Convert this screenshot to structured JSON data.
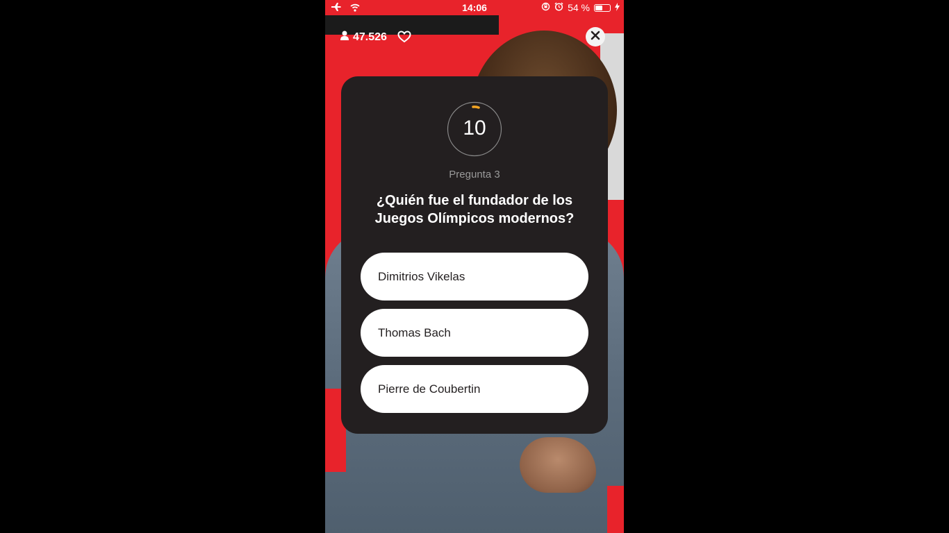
{
  "status_bar": {
    "time": "14:06",
    "battery_percent_text": "54 %",
    "battery_level": 0.54,
    "icons": [
      "airplane-icon",
      "wifi-icon",
      "rotation-lock-icon",
      "alarm-icon",
      "battery-icon",
      "charging-icon"
    ]
  },
  "header": {
    "viewer_count": "47.526",
    "icons": [
      "user-icon",
      "heart-icon",
      "close-icon"
    ]
  },
  "quiz": {
    "timer_value": "10",
    "question_label": "Pregunta 3",
    "question_line1": "¿Quién fue el fundador de los",
    "question_line2": "Juegos Olímpicos modernos?",
    "answers": [
      {
        "label": "Dimitrios Vikelas"
      },
      {
        "label": "Thomas Bach"
      },
      {
        "label": "Pierre de Coubertin"
      }
    ]
  },
  "colors": {
    "accent_red": "#e8232b",
    "card_dark": "#231f20",
    "timer_accent": "#f5a623",
    "answer_bg": "#ffffff"
  }
}
